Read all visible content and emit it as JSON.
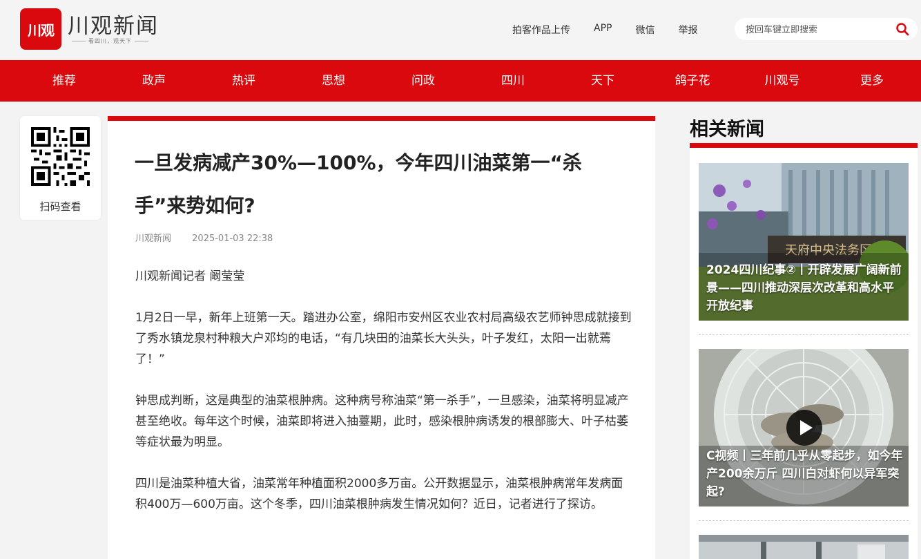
{
  "brand": {
    "logo_text": "川观",
    "name": "川观新闻",
    "slogan": "看四川，观天下",
    "accent": "#d9090d"
  },
  "top_links": [
    "拍客作品上传",
    "APP",
    "微信",
    "举报"
  ],
  "search": {
    "placeholder": "按回车键立即搜索",
    "icon": "search-icon"
  },
  "nav": [
    "推荐",
    "政声",
    "热评",
    "思想",
    "问政",
    "四川",
    "天下",
    "鸽子花",
    "川观号",
    "更多"
  ],
  "qr": {
    "label": "扫码查看"
  },
  "article": {
    "title": "一旦发病减产30%—100%，今年四川油菜第一“杀手”来势如何?",
    "source": "川观新闻",
    "datetime": "2025-01-03 22:38",
    "paragraphs": [
      "川观新闻记者 阚莹莹",
      "1月2日一早，新年上班第一天。踏进办公室，绵阳市安州区农业农村局高级农艺师钟思成就接到了秀水镇龙泉村种粮大户邓均的电话，“有几块田的油菜长大头头，叶子发红，太阳一出就蔫了！”",
      "钟思成判断，这是典型的油菜根肿病。这种病号称油菜“第一杀手”，一旦感染，油菜将明显减产甚至绝收。每年这个时候，油菜即将进入抽薹期，此时，感染根肿病诱发的根部膨大、叶子枯萎等症状最为明显。",
      "四川是油菜种植大省，油菜常年种植面积2000多万亩。公开数据显示，油菜根肿病常年发病面积400万—600万亩。这个冬季，四川油菜根肿病发生情况如何？近日，记者进行了探访。"
    ]
  },
  "related": {
    "title": "相关新闻",
    "items": [
      {
        "caption": "2024四川纪事②丨开辟发展广阔新前景——四川推动深层次改革和高水平开放纪事"
      },
      {
        "caption": "C视频丨三年前几乎从零起步，如今年产200余万斤 四川白对虾何以异军突起?",
        "video": true
      }
    ]
  }
}
